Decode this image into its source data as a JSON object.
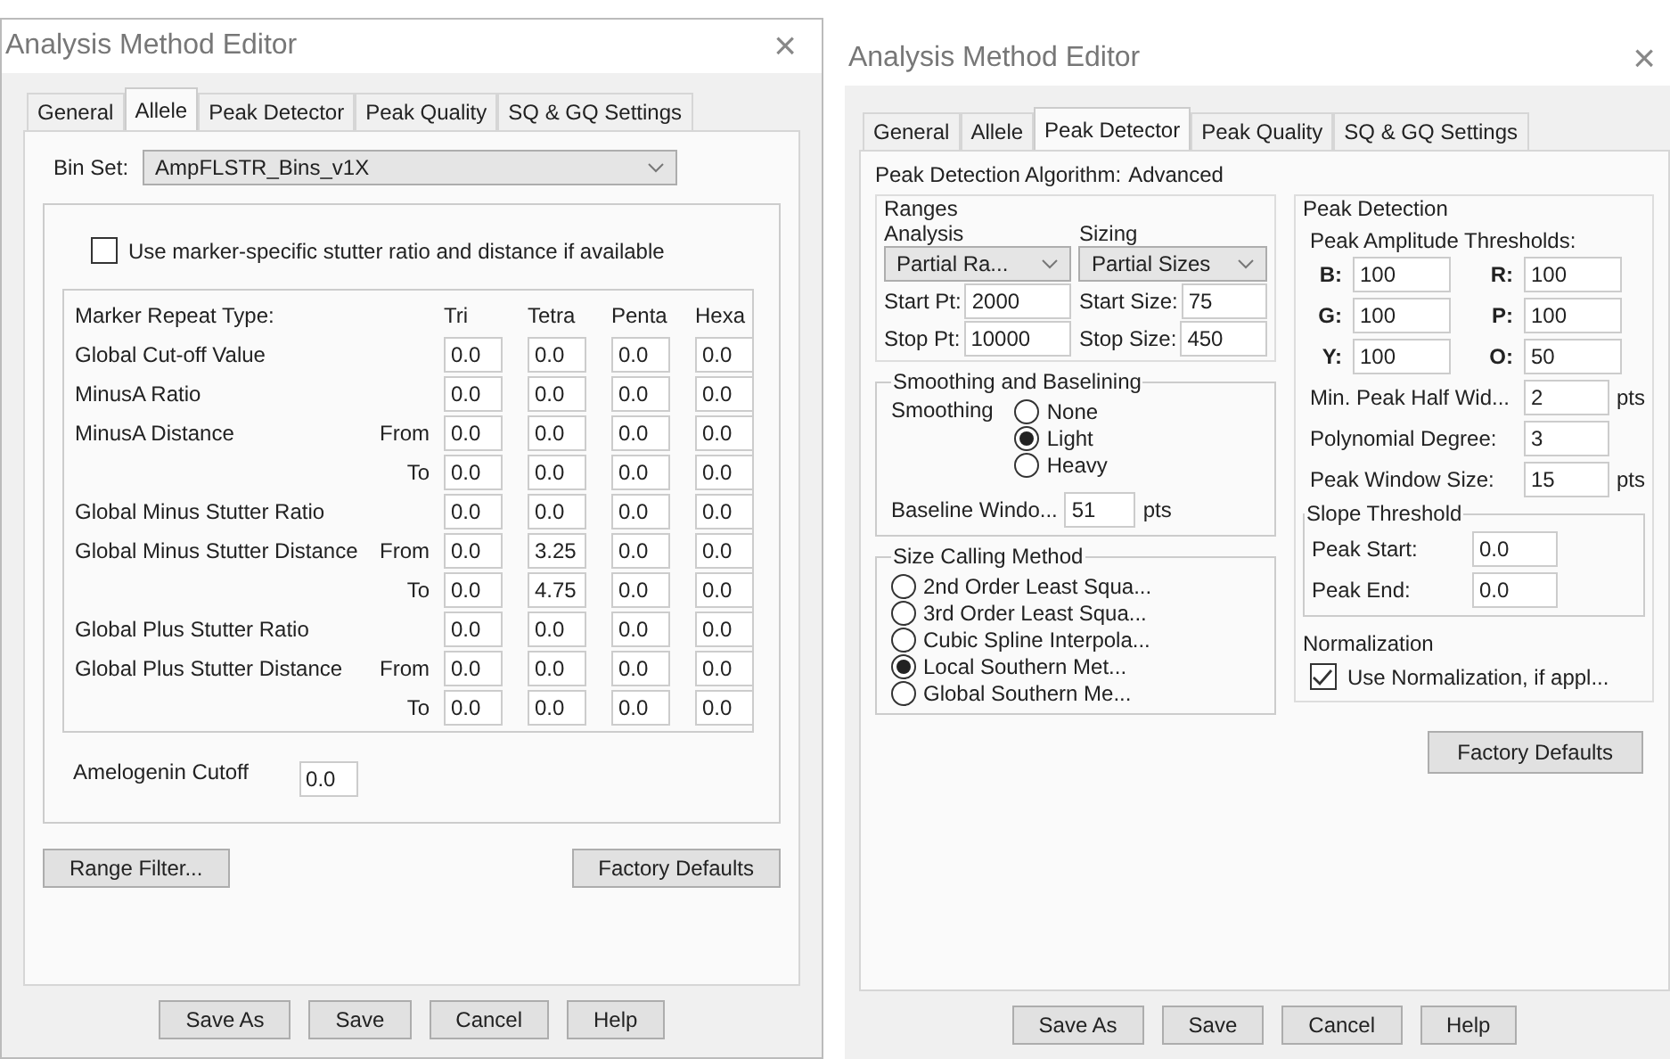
{
  "left_dialog": {
    "title": "Analysis Method Editor",
    "close": "×",
    "tabs": [
      {
        "label": "General",
        "selected": false
      },
      {
        "label": "Allele",
        "selected": true
      },
      {
        "label": "Peak Detector",
        "selected": false
      },
      {
        "label": "Peak Quality",
        "selected": false
      },
      {
        "label": "SQ & GQ Settings",
        "selected": false
      }
    ],
    "bin_set": {
      "label": "Bin Set:",
      "value": "AmpFLSTR_Bins_v1X"
    },
    "stutter_option": {
      "label": "Use marker-specific stutter ratio and distance if available",
      "checked": false
    },
    "table": {
      "header": "Marker Repeat Type:",
      "columns": [
        "Tri",
        "Tetra",
        "Penta",
        "Hexa"
      ],
      "rows": [
        {
          "label": "Global Cut-off Value",
          "values": [
            "0.0",
            "0.0",
            "0.0",
            "0.0"
          ]
        },
        {
          "label": "MinusA Ratio",
          "values": [
            "0.0",
            "0.0",
            "0.0",
            "0.0"
          ]
        },
        {
          "label": "MinusA Distance",
          "sub": "From",
          "values": [
            "0.0",
            "0.0",
            "0.0",
            "0.0"
          ]
        },
        {
          "sub": "To",
          "values": [
            "0.0",
            "0.0",
            "0.0",
            "0.0"
          ]
        },
        {
          "label": "Global Minus Stutter Ratio",
          "values": [
            "0.0",
            "0.0",
            "0.0",
            "0.0"
          ]
        },
        {
          "label": "Global Minus Stutter Distance",
          "sub": "From",
          "values": [
            "0.0",
            "3.25",
            "0.0",
            "0.0"
          ]
        },
        {
          "sub": "To",
          "values": [
            "0.0",
            "4.75",
            "0.0",
            "0.0"
          ]
        },
        {
          "label": "Global Plus Stutter Ratio",
          "values": [
            "0.0",
            "0.0",
            "0.0",
            "0.0"
          ]
        },
        {
          "label": "Global Plus Stutter Distance",
          "sub": "From",
          "values": [
            "0.0",
            "0.0",
            "0.0",
            "0.0"
          ]
        },
        {
          "sub": "To",
          "values": [
            "0.0",
            "0.0",
            "0.0",
            "0.0"
          ]
        }
      ]
    },
    "amelogenin": {
      "label": "Amelogenin Cutoff",
      "value": "0.0"
    },
    "range_filter": "Range Filter...",
    "factory_defaults": "Factory Defaults",
    "buttons": [
      "Save As",
      "Save",
      "Cancel",
      "Help"
    ]
  },
  "right_dialog": {
    "title": "Analysis Method Editor",
    "close": "×",
    "tabs": [
      {
        "label": "General",
        "selected": false
      },
      {
        "label": "Allele",
        "selected": false
      },
      {
        "label": "Peak Detector",
        "selected": true
      },
      {
        "label": "Peak Quality",
        "selected": false
      },
      {
        "label": "SQ & GQ Settings",
        "selected": false
      }
    ],
    "algorithm": {
      "label": "Peak Detection Algorithm:",
      "value": "Advanced"
    },
    "ranges": {
      "title": "Ranges",
      "analysis": {
        "label": "Analysis",
        "select": "Partial Ra...",
        "start_label": "Start Pt:",
        "start": "2000",
        "stop_label": "Stop Pt:",
        "stop": "10000"
      },
      "sizing": {
        "label": "Sizing",
        "select": "Partial Sizes",
        "start_label": "Start Size:",
        "start": "75",
        "stop_label": "Stop Size:",
        "stop": "450"
      }
    },
    "smoothing": {
      "title": "Smoothing and Baselining",
      "label": "Smoothing",
      "options": [
        {
          "label": "None",
          "selected": false
        },
        {
          "label": "Light",
          "selected": true
        },
        {
          "label": "Heavy",
          "selected": false
        }
      ],
      "baseline_label": "Baseline Windo...",
      "baseline": "51",
      "baseline_unit": "pts"
    },
    "size_calling": {
      "title": "Size Calling Method",
      "options": [
        {
          "label": "2nd Order Least Squa...",
          "selected": false
        },
        {
          "label": "3rd Order Least Squa...",
          "selected": false
        },
        {
          "label": "Cubic Spline Interpola...",
          "selected": false
        },
        {
          "label": "Local Southern Met...",
          "selected": true
        },
        {
          "label": "Global Southern Me...",
          "selected": false
        }
      ]
    },
    "peak_detection": {
      "title": "Peak Detection",
      "thresholds_label": "Peak Amplitude Thresholds:",
      "thresholds": [
        {
          "label": "B:",
          "value": "100"
        },
        {
          "label": "R:",
          "value": "100"
        },
        {
          "label": "G:",
          "value": "100"
        },
        {
          "label": "P:",
          "value": "100"
        },
        {
          "label": "Y:",
          "value": "100"
        },
        {
          "label": "O:",
          "value": "50"
        }
      ],
      "params": [
        {
          "label": "Min. Peak Half Wid...",
          "value": "2",
          "unit": "pts"
        },
        {
          "label": "Polynomial Degree:",
          "value": "3"
        },
        {
          "label": "Peak Window Size:",
          "value": "15",
          "unit": "pts"
        }
      ]
    },
    "slope": {
      "title": "Slope Threshold",
      "rows": [
        {
          "label": "Peak Start:",
          "value": "0.0"
        },
        {
          "label": "Peak End:",
          "value": "0.0"
        }
      ]
    },
    "normalization": {
      "title": "Normalization",
      "label": "Use Normalization, if appl...",
      "checked": true
    },
    "factory_defaults": "Factory Defaults",
    "buttons": [
      "Save As",
      "Save",
      "Cancel",
      "Help"
    ]
  }
}
